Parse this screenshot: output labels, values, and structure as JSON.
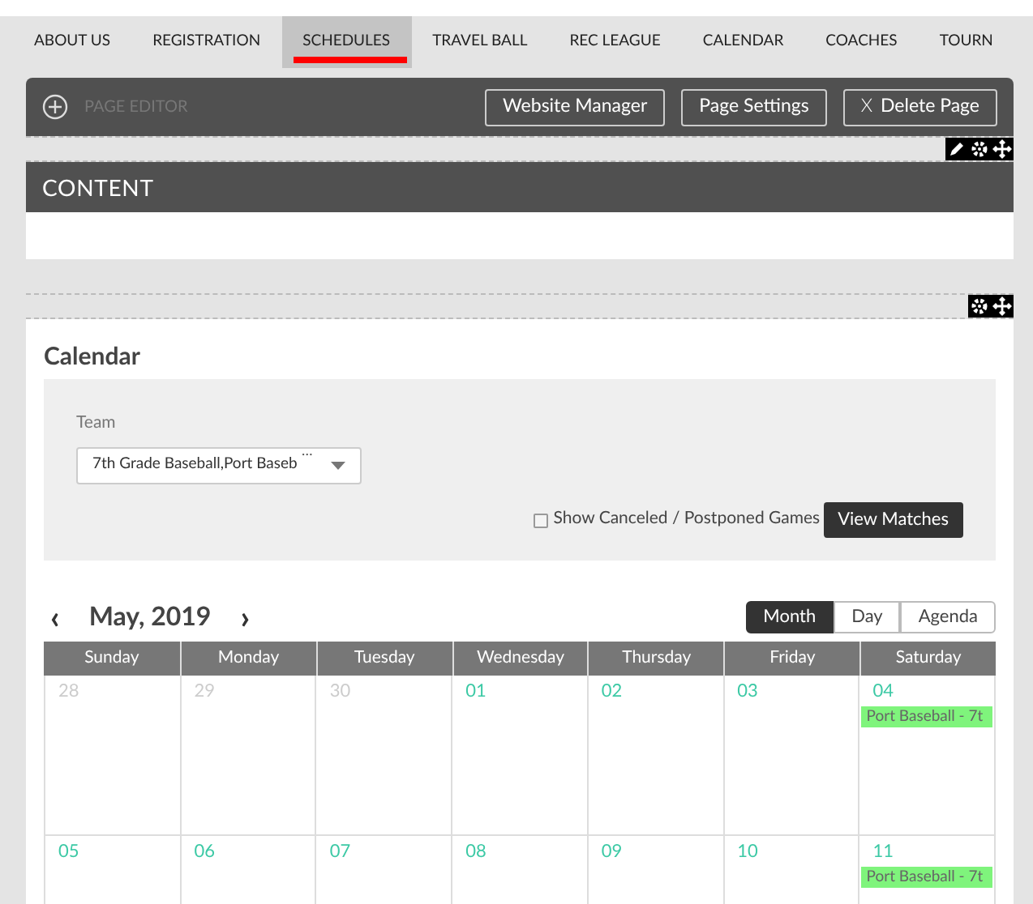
{
  "nav": [
    {
      "label": "ABOUT US",
      "selected": false
    },
    {
      "label": "REGISTRATION",
      "selected": false
    },
    {
      "label": "SCHEDULES",
      "selected": true
    },
    {
      "label": "TRAVEL BALL",
      "selected": false
    },
    {
      "label": "REC LEAGUE",
      "selected": false
    },
    {
      "label": "CALENDAR",
      "selected": false
    },
    {
      "label": "COACHES",
      "selected": false
    },
    {
      "label": "TOURN",
      "selected": false
    }
  ],
  "editor": {
    "title": "PAGE EDITOR",
    "buttons": [
      {
        "label": "Website Manager",
        "kind": "plain"
      },
      {
        "label": "Page Settings",
        "kind": "plain"
      },
      {
        "label": "Delete Page",
        "kind": "delete",
        "icon": "X"
      }
    ]
  },
  "content_block": {
    "title": "CONTENT"
  },
  "calendar": {
    "title": "Calendar",
    "filter": {
      "label": "Team",
      "value": "7th Grade Baseball,Port Baseb",
      "overflow": "…",
      "checkbox": {
        "label": "Show Canceled / Postponed Games",
        "checked": false
      },
      "button": "View Matches"
    },
    "prev": "‹",
    "month": "May, 2019",
    "next": "›",
    "views": [
      {
        "label": "Month",
        "selected": true
      },
      {
        "label": "Day",
        "selected": false
      },
      {
        "label": "Agenda",
        "selected": false
      }
    ],
    "weekdays": [
      "Sunday",
      "Monday",
      "Tuesday",
      "Wednesday",
      "Thursday",
      "Friday",
      "Saturday"
    ],
    "weeks": [
      [
        {
          "day": "28",
          "muted": true
        },
        {
          "day": "29",
          "muted": true
        },
        {
          "day": "30",
          "muted": true
        },
        {
          "day": "01",
          "muted": false
        },
        {
          "day": "02",
          "muted": false
        },
        {
          "day": "03",
          "muted": false
        },
        {
          "day": "04",
          "muted": false,
          "events": [
            "Port Baseball - 7t"
          ]
        }
      ],
      [
        {
          "day": "05",
          "muted": false
        },
        {
          "day": "06",
          "muted": false
        },
        {
          "day": "07",
          "muted": false
        },
        {
          "day": "08",
          "muted": false
        },
        {
          "day": "09",
          "muted": false
        },
        {
          "day": "10",
          "muted": false
        },
        {
          "day": "11",
          "muted": false,
          "events": [
            "Port Baseball - 7t"
          ]
        }
      ]
    ]
  }
}
